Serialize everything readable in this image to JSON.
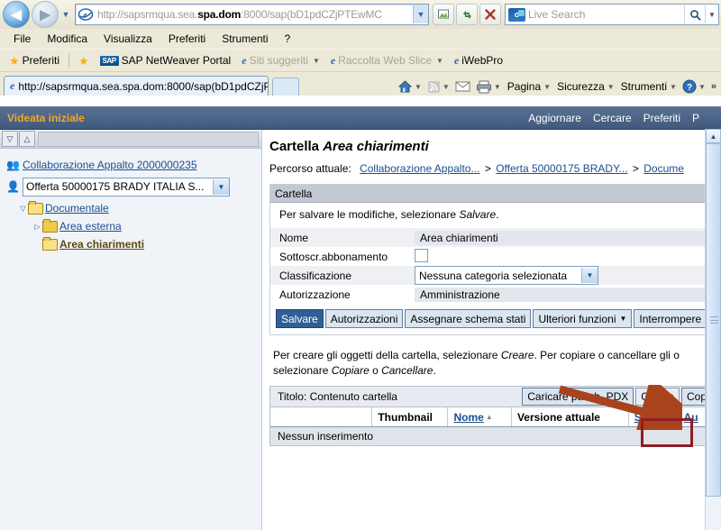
{
  "browser": {
    "nav": {
      "back_label": "◀",
      "forward_label": "▶",
      "history_dropdown": "▼",
      "back_name": "Indietro",
      "forward_name": "Avanti"
    },
    "address": {
      "value_pre": "http://sapsrmqua.sea.",
      "value_bold": "spa.dom",
      "value_post": ":8000/sap(bD1pdCZjPTEwMC",
      "full": "http://sapsrmqua.sea.spa.dom:8000/sap(bD1pdCZjPTEwMC",
      "dropdown": "▼",
      "icon": "ie-page-icon"
    },
    "toolbar_buttons": [
      {
        "name": "compatibility-view-icon",
        "glyph": "⬚"
      },
      {
        "name": "refresh-icon",
        "glyph": "↺"
      },
      {
        "name": "stop-icon",
        "glyph": "✕"
      }
    ],
    "search": {
      "placeholder": "Live Search",
      "logo_text": "o",
      "go_glyph": "⚲",
      "dropdown_glyph": "▼"
    },
    "menu": [
      "File",
      "Modifica",
      "Visualizza",
      "Preferiti",
      "Strumenti",
      "?"
    ],
    "favorites_bar": {
      "favorites_label": "Preferiti",
      "items": [
        {
          "label": "SAP NetWeaver Portal",
          "icon": "sap-icon",
          "dim": false,
          "caret": false
        },
        {
          "label": "Siti suggeriti",
          "icon": "ie-icon",
          "dim": true,
          "caret": true
        },
        {
          "label": "Raccolta Web Slice",
          "icon": "ie-icon",
          "dim": true,
          "caret": true
        },
        {
          "label": "iWebPro",
          "icon": "ie-icon",
          "dim": false,
          "caret": false
        }
      ]
    },
    "tab": {
      "title": "http://sapsrmqua.sea.spa.dom:8000/sap(bD1pdCZjP...",
      "icon": "ie-icon",
      "new_tab_name": "new-tab-button"
    },
    "command_bar": {
      "items": [
        {
          "label": "",
          "name": "home-icon",
          "glyph": "⌂",
          "caret": true
        },
        {
          "label": "",
          "name": "feeds-icon",
          "glyph": "◉",
          "caret": true
        },
        {
          "label": "",
          "name": "mail-icon",
          "glyph": "✉",
          "caret": false
        },
        {
          "label": "",
          "name": "print-icon",
          "glyph": "⎙",
          "caret": true
        },
        {
          "label": "Pagina",
          "name": "page-menu",
          "glyph": "",
          "caret": true
        },
        {
          "label": "Sicurezza",
          "name": "security-menu",
          "glyph": "",
          "caret": true
        },
        {
          "label": "Strumenti",
          "name": "tools-menu",
          "glyph": "",
          "caret": true
        },
        {
          "label": "",
          "name": "help-icon",
          "glyph": "?",
          "caret": true
        }
      ],
      "overflow": "»"
    }
  },
  "sap": {
    "header": {
      "title": "Videata iniziale",
      "links": [
        "Aggiornare",
        "Cercare",
        "Preferiti",
        "P"
      ]
    },
    "tree_toolbar": {
      "collapse_icon": "▽",
      "expand_icon": "△"
    },
    "tree": {
      "root": {
        "label": "Collaborazione Appalto 2000000235",
        "icon": "collaboration-icon"
      },
      "offerta": {
        "label": "Offerta 50000175 BRADY ITALIA S...",
        "icon": "user-icon",
        "dropdown": "▼"
      },
      "nodes": [
        {
          "label": "Documentale",
          "level": 1,
          "expander": "▽",
          "icon": "folder-open-icon",
          "current": false
        },
        {
          "label": "Area esterna",
          "level": 2,
          "expander": "▷",
          "icon": "folder-icon",
          "current": false
        },
        {
          "label": "Area chiarimenti",
          "level": 2,
          "expander": "",
          "icon": "folder-open-icon",
          "current": true
        }
      ]
    },
    "content": {
      "title_prefix": "Cartella",
      "title_name": "Area chiarimenti",
      "breadcrumb": {
        "label": "Percorso attuale:",
        "items": [
          "Collaborazione Appalto...",
          "Offerta 50000175 BRADY...",
          "Docume"
        ],
        "separator": ">"
      },
      "panel": {
        "header": "Cartella",
        "note_pre": "Per salvare le modifiche, selezionare ",
        "note_em": "Salvare",
        "note_post": ".",
        "fields": [
          {
            "label": "Nome",
            "value": "Area chiarimenti",
            "type": "readonly"
          },
          {
            "label": "Sottoscr.abbonamento",
            "value": "",
            "type": "checkbox",
            "checked": false
          },
          {
            "label": "Classificazione",
            "value": "Nessuna categoria selezionata",
            "type": "dropdown"
          },
          {
            "label": "Autorizzazione",
            "value": "Amministrazione",
            "type": "readonly"
          }
        ],
        "buttons": [
          {
            "label": "Salvare",
            "primary": true,
            "menu": false
          },
          {
            "label": "Autorizzazioni",
            "primary": false,
            "menu": false
          },
          {
            "label": "Assegnare schema stati",
            "primary": false,
            "menu": false
          },
          {
            "label": "Ulteriori funzioni",
            "primary": false,
            "menu": true
          },
          {
            "label": "Interrompere",
            "primary": false,
            "menu": false
          }
        ]
      },
      "mid_note": {
        "l1_a": "Per creare gli oggetti della cartella, selezionare ",
        "l1_em": "Creare",
        "l1_b": ". Per copiare o cancellare gli o",
        "l2_a": "selezionare ",
        "l2_em1": "Copiare",
        "l2_b": " o ",
        "l2_em2": "Cancellare",
        "l2_c": "."
      },
      "table": {
        "title": "Titolo: Contenuto cartella",
        "actions": [
          {
            "label": "Caricare pacch. PDX",
            "highlighted": false
          },
          {
            "label": "Creare",
            "highlighted": true
          },
          {
            "label": "Cop",
            "highlighted": false
          }
        ],
        "columns": [
          {
            "label": "",
            "width": 110,
            "link": false,
            "sort": ""
          },
          {
            "label": "Thumbnail",
            "width": 78,
            "link": false,
            "sort": ""
          },
          {
            "label": "Nome",
            "width": 63,
            "link": true,
            "sort": "▲"
          },
          {
            "label": "Versione attuale",
            "width": 128,
            "link": false,
            "sort": ""
          },
          {
            "label": "Stato",
            "width": 46,
            "link": true,
            "sort": ""
          },
          {
            "label": "Au",
            "width": 30,
            "link": true,
            "sort": ""
          }
        ],
        "empty_row": "Nessun inserimento"
      }
    },
    "annotations": {
      "arrow_color": "#a8431c",
      "rect_color": "#8e1d24",
      "target": "Creare"
    },
    "scrollbar": {
      "up_glyph": "▲",
      "down_glyph": "▼"
    }
  }
}
